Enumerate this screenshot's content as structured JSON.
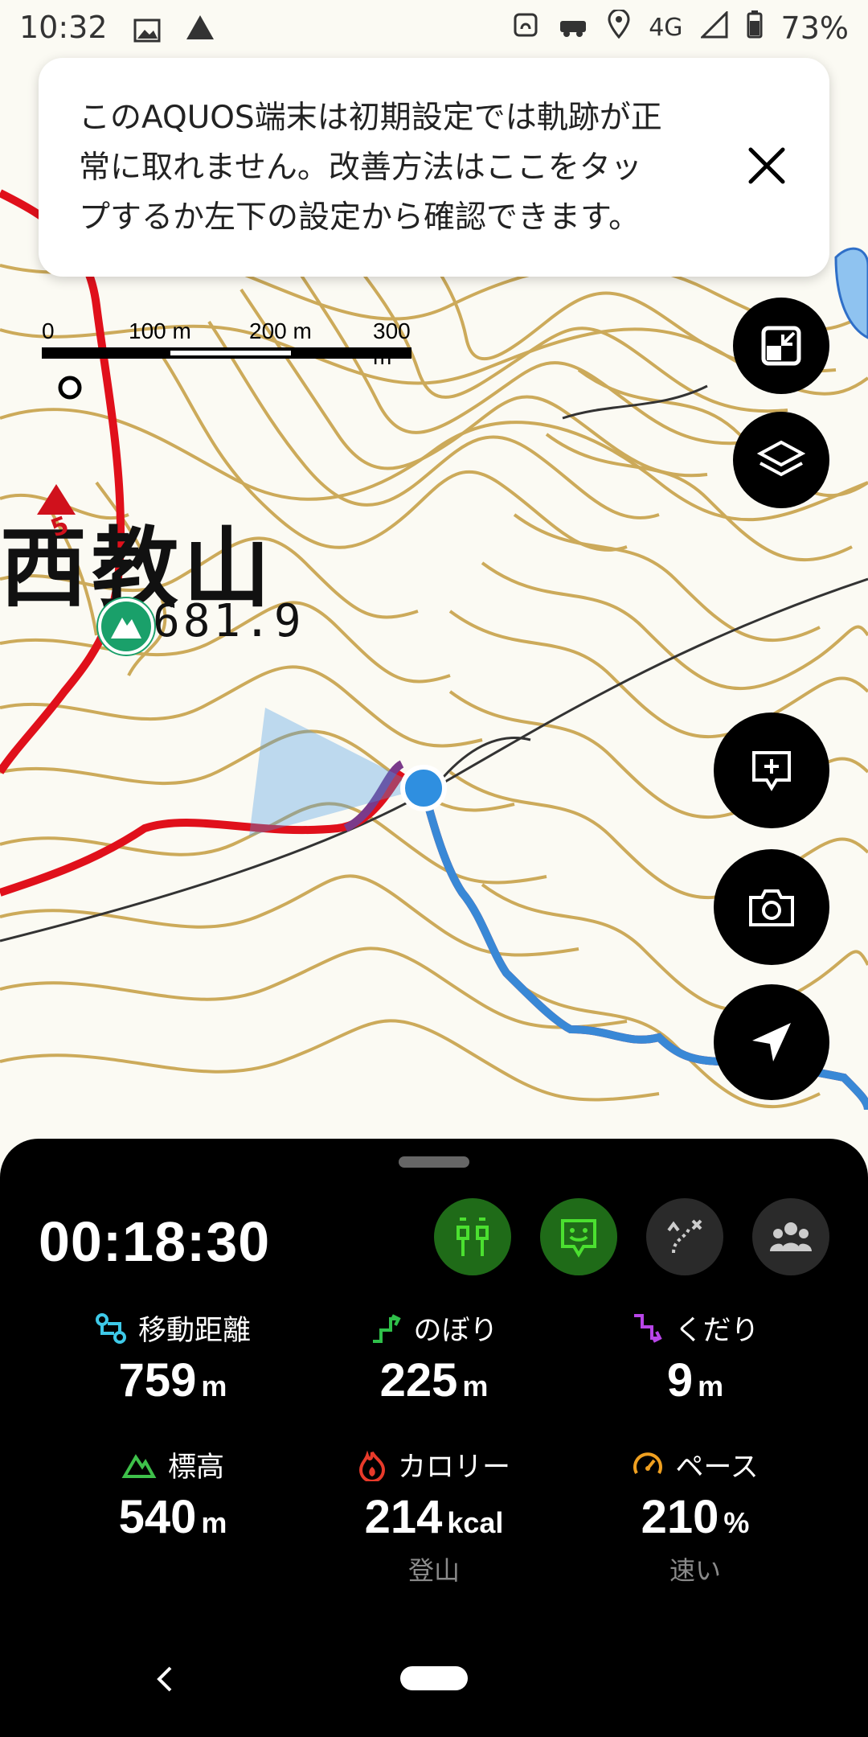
{
  "status_bar": {
    "time": "10:32",
    "network": "4G",
    "battery": "73%"
  },
  "banner": {
    "line1": "このAQUOS端末は初期設定では軌跡が正",
    "line2": "常に取れません。改善方法はここをタッ",
    "line3": "プするか左下の設定から確認できます。"
  },
  "scale_bar": {
    "labels": [
      "0",
      "100 m",
      "200 m",
      "300 m"
    ]
  },
  "map_labels": {
    "mountain_name": "西教山",
    "elevation": "681.9",
    "route_marker": "5"
  },
  "colors": {
    "contour": "#c8a24a",
    "route_red": "#e0101b",
    "track_blue": "#2f8fe0",
    "panel_bg": "#000000",
    "accent_green": "#1f6b18"
  },
  "panel": {
    "timer": "00:18:30",
    "stats": [
      {
        "label": "移動距離",
        "value": "759",
        "unit": "m",
        "icon": "distance-icon",
        "sub": ""
      },
      {
        "label": "のぼり",
        "value": "225",
        "unit": "m",
        "icon": "ascent-icon",
        "sub": ""
      },
      {
        "label": "くだり",
        "value": "9",
        "unit": "m",
        "icon": "descent-icon",
        "sub": ""
      },
      {
        "label": "標高",
        "value": "540",
        "unit": "m",
        "icon": "elevation-icon",
        "sub": ""
      },
      {
        "label": "カロリー",
        "value": "214",
        "unit": "kcal",
        "icon": "calorie-icon",
        "sub": "登山"
      },
      {
        "label": "ペース",
        "value": "210",
        "unit": "%",
        "icon": "pace-icon",
        "sub": "速い"
      }
    ]
  }
}
